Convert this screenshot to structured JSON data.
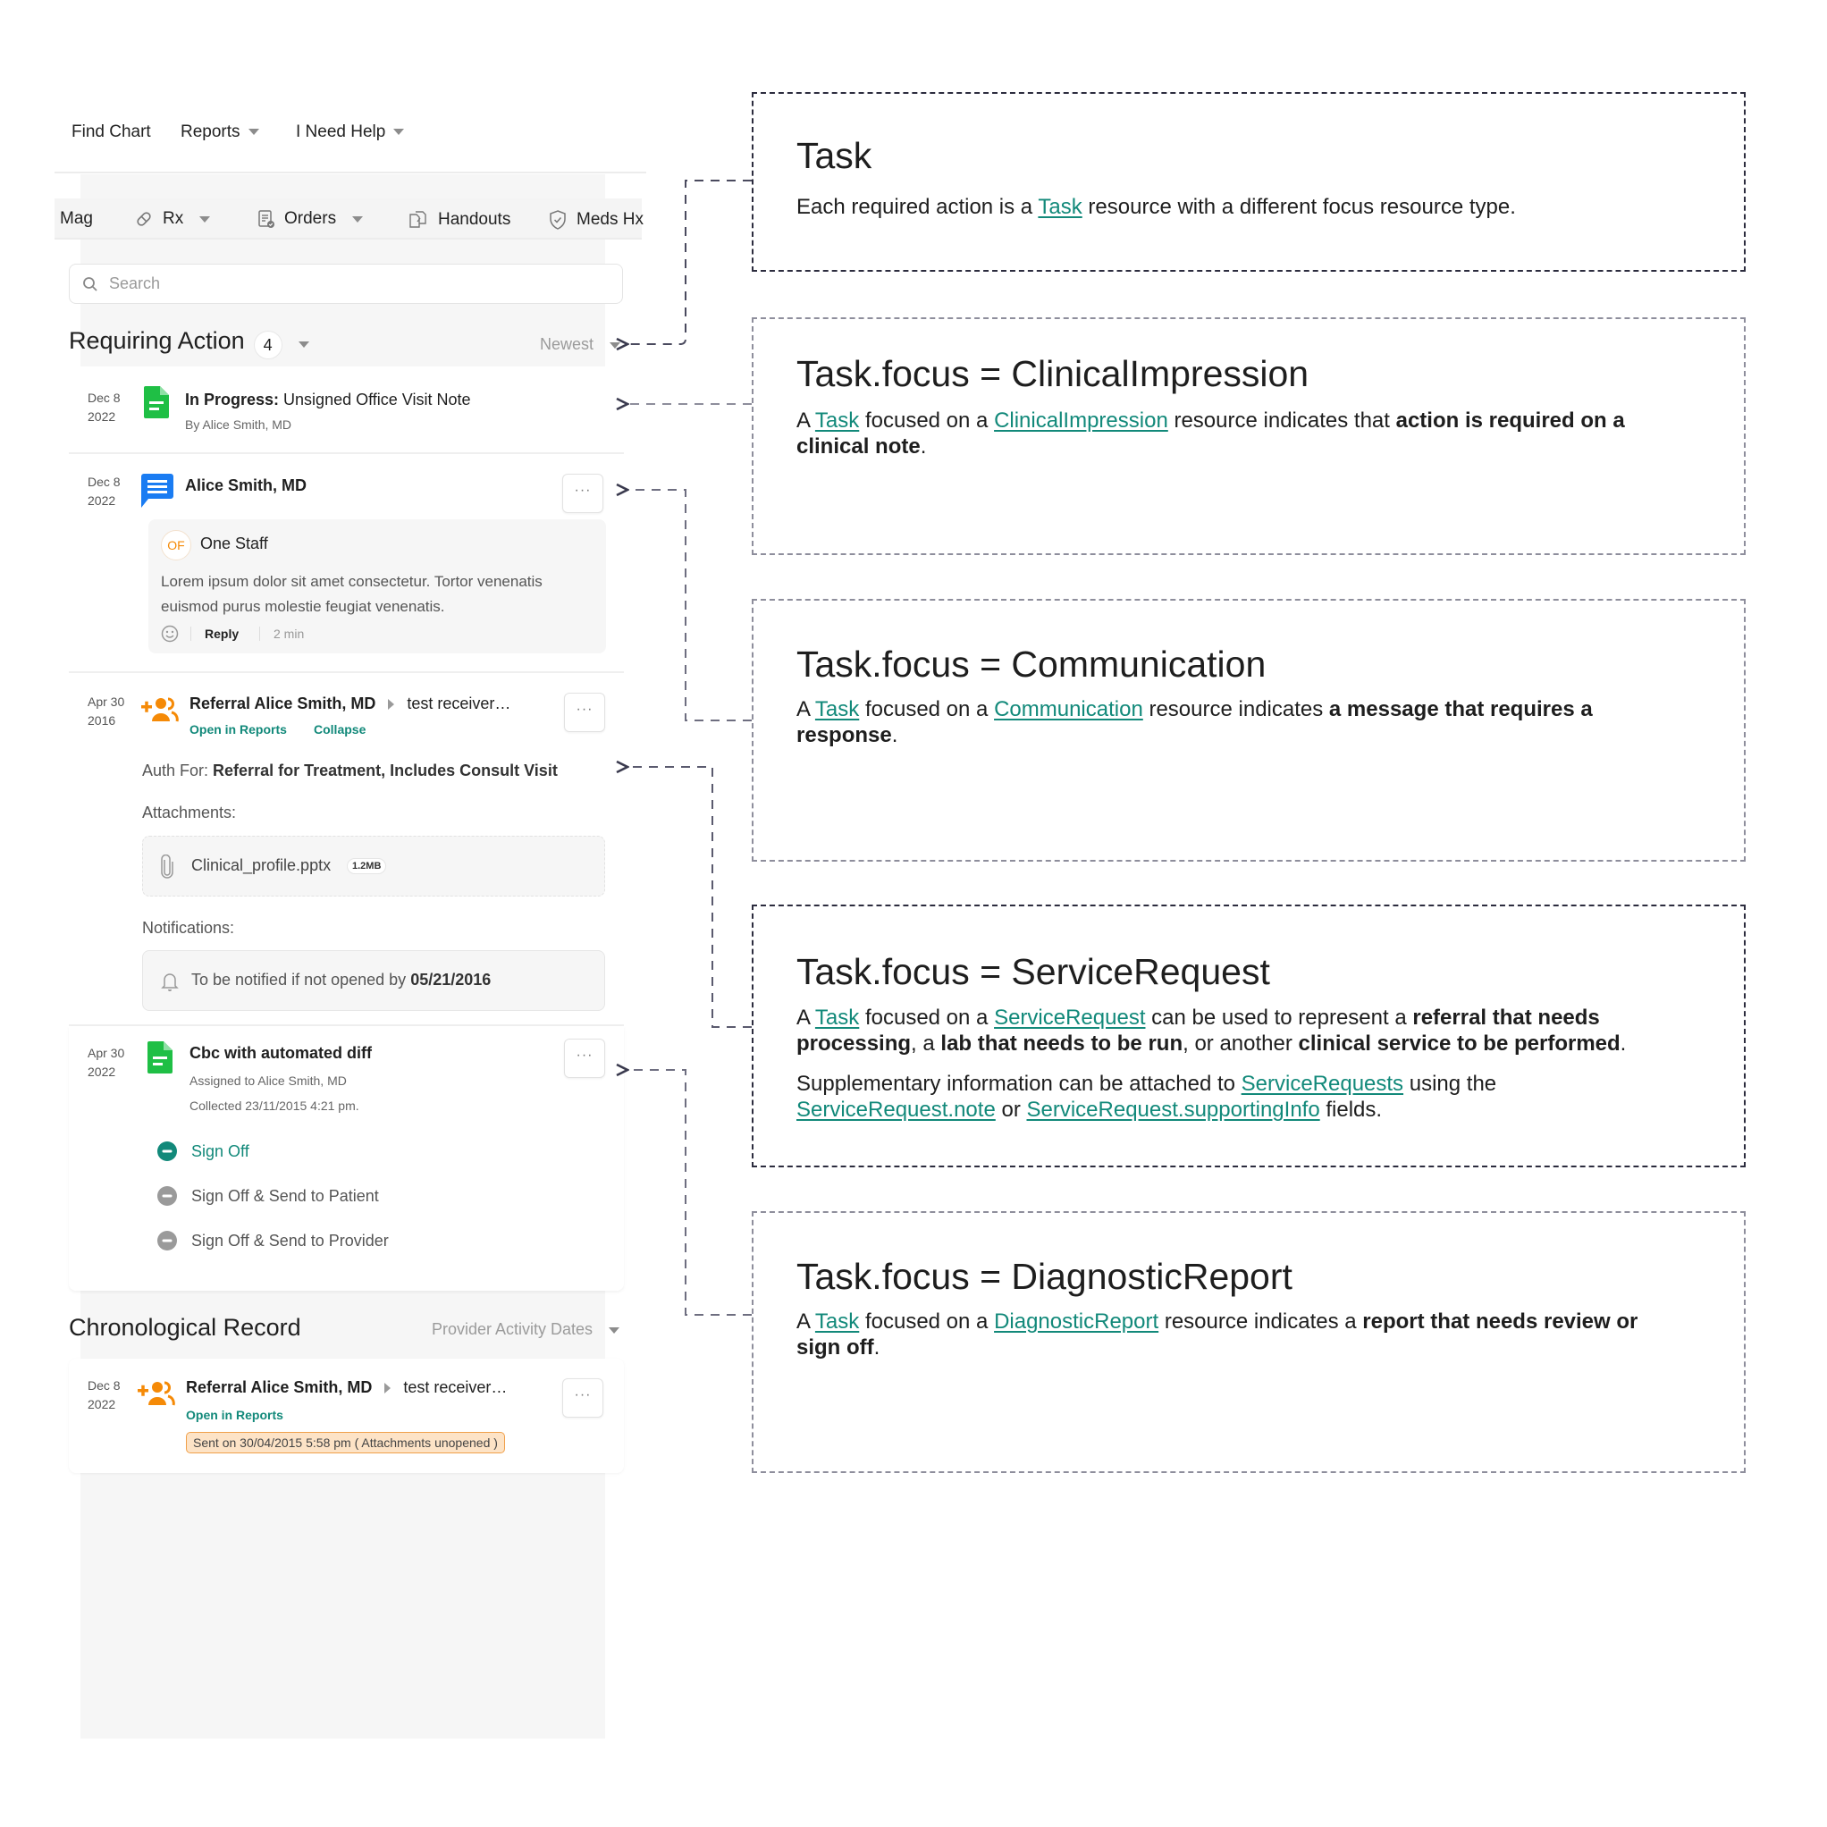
{
  "top_nav": {
    "find_chart": "Find Chart",
    "reports": "Reports",
    "need_help": "I Need Help"
  },
  "toolbar": {
    "items": [
      {
        "label": "Mag",
        "icon": null
      },
      {
        "label": "Rx",
        "icon": "pill-icon",
        "dropdown": true
      },
      {
        "label": "Orders",
        "icon": "orders-document-icon",
        "dropdown": true
      },
      {
        "label": "Handouts",
        "icon": "handouts-icon"
      },
      {
        "label": "Meds Hx",
        "icon": "shield-check-icon"
      }
    ]
  },
  "search": {
    "placeholder": "Search",
    "value": ""
  },
  "requiring_action": {
    "title": "Requiring Action",
    "count": "4",
    "sort_label": "Newest",
    "items": [
      {
        "date_line1": "Dec 8",
        "date_line2": "2022",
        "icon": "document-icon",
        "status": "In Progress:",
        "title": "Unsigned Office Visit Note",
        "byline": "By Alice Smith, MD"
      },
      {
        "date_line1": "Dec 8",
        "date_line2": "2022",
        "icon": "message-icon",
        "title": "Alice Smith, MD",
        "more_label": "···",
        "message": {
          "avatar_initials": "OF",
          "author": "One Staff",
          "body": "Lorem ipsum dolor sit amet consectetur. Tortor venenatis euismod purus molestie feugiat venenatis.",
          "reply_label": "Reply",
          "time": "2 min"
        }
      },
      {
        "date_line1": "Apr 30",
        "date_line2": "2016",
        "icon": "referral-add-user-icon",
        "title": "Referral Alice Smith, MD",
        "recipient": "test receiver…",
        "open_in_reports": "Open in Reports",
        "collapse": "Collapse",
        "more_label": "···",
        "auth_label": "Auth For:",
        "auth_value": "Referral for Treatment, Includes Consult Visit",
        "attachments_label": "Attachments:",
        "attachment_name": "Clinical_profile.pptx",
        "attachment_size": "1.2MB",
        "notifications_label": "Notifications:",
        "notification_text": "To be notified if not opened by",
        "notification_date": "05/21/2016"
      },
      {
        "date_line1": "Apr 30",
        "date_line2": "2022",
        "icon": "document-icon",
        "title": "Cbc with automated diff",
        "assigned": "Assigned to Alice Smith, MD",
        "collected": "Collected 23/11/2015 4:21 pm.",
        "more_label": "···",
        "actions": [
          {
            "label": "Sign Off",
            "selected": true
          },
          {
            "label": "Sign Off & Send to Patient",
            "selected": false
          },
          {
            "label": "Sign Off & Send to Provider",
            "selected": false
          }
        ]
      }
    ]
  },
  "chronological_record": {
    "title": "Chronological Record",
    "sort_label": "Provider Activity Dates",
    "items": [
      {
        "date_line1": "Dec 8",
        "date_line2": "2022",
        "icon": "referral-add-user-icon",
        "title": "Referral Alice Smith, MD",
        "recipient": "test receiver…",
        "open_in_reports": "Open in Reports",
        "more_label": "···",
        "sent_badge": "Sent on 30/04/2015 5:58 pm ( Attachments unopened )"
      }
    ]
  },
  "annotations": [
    {
      "title": "Task",
      "paragraphs": [
        [
          {
            "t": "Each required action is a "
          },
          {
            "link": "Task"
          },
          {
            "t": " resource with a different focus resource type."
          }
        ]
      ]
    },
    {
      "title": "Task.focus = ClinicalImpression",
      "paragraphs": [
        [
          {
            "t": "A "
          },
          {
            "link": "Task"
          },
          {
            "t": " focused on a "
          },
          {
            "link": "ClinicalImpression"
          },
          {
            "t": " resource indicates that "
          },
          {
            "b": "action is required on a clinical note"
          },
          {
            "t": "."
          }
        ]
      ]
    },
    {
      "title": "Task.focus = Communication",
      "paragraphs": [
        [
          {
            "t": "A "
          },
          {
            "link": "Task"
          },
          {
            "t": " focused on a "
          },
          {
            "link": "Communication"
          },
          {
            "t": " resource indicates "
          },
          {
            "b": "a message that requires a response"
          },
          {
            "t": "."
          }
        ]
      ]
    },
    {
      "title": "Task.focus = ServiceRequest",
      "paragraphs": [
        [
          {
            "t": "A "
          },
          {
            "link": "Task"
          },
          {
            "t": " focused on a "
          },
          {
            "link": "ServiceRequest"
          },
          {
            "t": " can be used to represent a "
          },
          {
            "b": "referral that needs processing"
          },
          {
            "t": ", a "
          },
          {
            "b": "lab that needs to be run"
          },
          {
            "t": ", or another "
          },
          {
            "b": "clinical service to be performed"
          },
          {
            "t": "."
          }
        ],
        [
          {
            "t": "Supplementary information can be attached to "
          },
          {
            "link": "ServiceRequests"
          },
          {
            "t": " using the "
          },
          {
            "link": "ServiceRequest.note"
          },
          {
            "t": " or "
          },
          {
            "link": "ServiceRequest.supportingInfo"
          },
          {
            "t": " fields."
          }
        ]
      ]
    },
    {
      "title": "Task.focus = DiagnosticReport",
      "paragraphs": [
        [
          {
            "t": "A "
          },
          {
            "link": "Task"
          },
          {
            "t": " focused on a "
          },
          {
            "link": "DiagnosticReport"
          },
          {
            "t": " resource indicates a "
          },
          {
            "b": "report that needs review or sign off"
          },
          {
            "t": "."
          }
        ]
      ]
    }
  ],
  "colors": {
    "accent_teal": "#12897a",
    "document_green": "#1fbf45",
    "message_blue": "#1a7cf2",
    "referral_orange": "#f58a07",
    "badge_bg": "#fde3c6",
    "badge_border": "#f0a04a"
  }
}
